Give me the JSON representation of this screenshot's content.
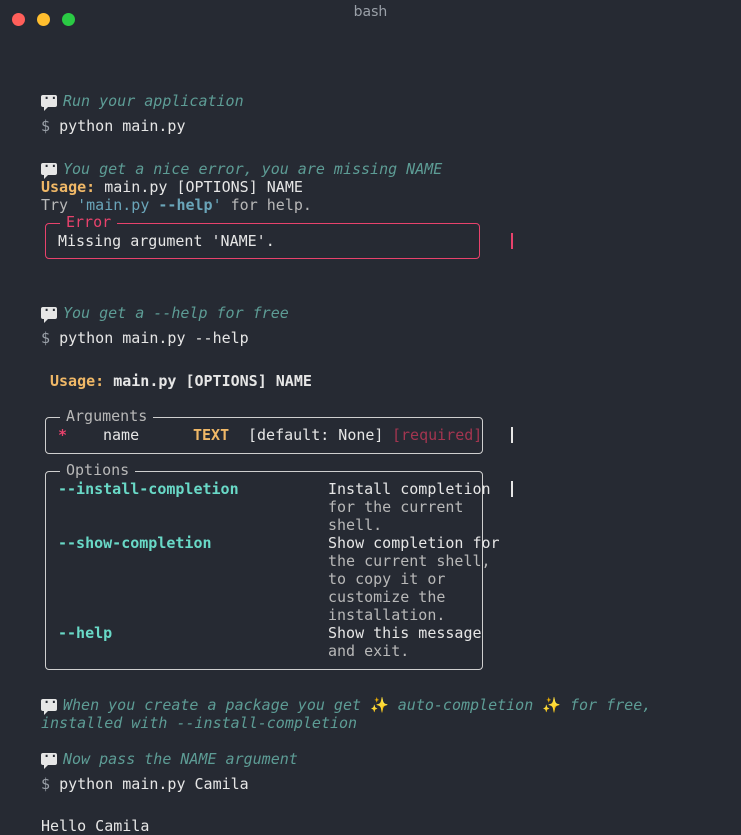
{
  "window": {
    "title": "bash"
  },
  "lines": {
    "c1": "Run your application",
    "p1": "$",
    "cmd1": "python main.py",
    "c2": "You get a nice error, you are missing NAME",
    "usage1_label": "Usage:",
    "usage1_rest": " main.py [OPTIONS] NAME",
    "try_a": "Try ",
    "try_b": "'main.py ",
    "try_c": "--help",
    "try_d": "'",
    "try_e": " for help.",
    "error_title": "Error",
    "error_msg": "Missing argument 'NAME'.",
    "c3": "You get a --help for free",
    "p2": "$",
    "cmd2": "python main.py --help",
    "usage2_label": "Usage:",
    "usage2_rest": " main.py [OPTIONS] NAME",
    "args_title": "Arguments",
    "arg_star": "*",
    "arg_name": "name",
    "arg_type": "TEXT",
    "arg_default": "[default: None]",
    "arg_required": "[required]",
    "options_title": "Options",
    "opt1": "--install-completion",
    "opt1_d1": "Install completion",
    "opt1_d2": "for the current",
    "opt1_d3": "shell.",
    "opt2": "--show-completion",
    "opt2_d1": "Show completion for",
    "opt2_d2": "the current shell,",
    "opt2_d3": "to copy it or",
    "opt2_d4": "customize the",
    "opt2_d5": "installation.",
    "opt3": "--help",
    "opt3_d1": "Show this message",
    "opt3_d2": "and exit.",
    "c4a": "When you create a package you get ",
    "sparkle": "✨",
    "c4b": " auto-completion ",
    "c4c": " for free,",
    "c4d": "installed with --install-completion",
    "c5": "Now pass the NAME argument",
    "p3": "$",
    "cmd3": "python main.py Camila",
    "out": "Hello Camila"
  },
  "colors": {
    "background": "#262a33",
    "comment": "#5d9c95",
    "accent": "#f0b867",
    "error": "#e8426c",
    "option": "#69d9c7"
  },
  "icons": [
    "speech-bubble-icon",
    "sparkles-icon"
  ]
}
